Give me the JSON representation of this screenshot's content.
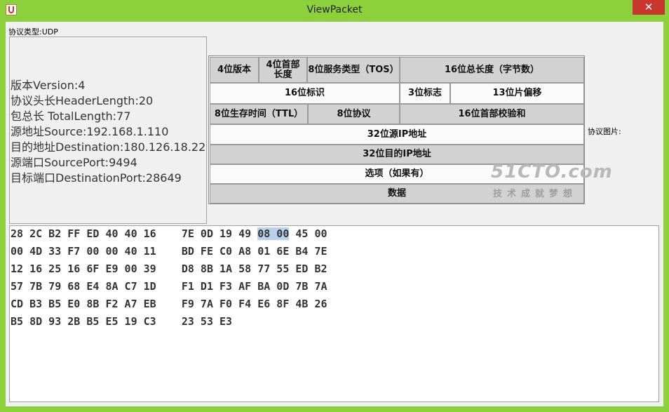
{
  "window": {
    "title": "ViewPacket",
    "close_glyph": "✕",
    "app_icon": "java-cup-icon"
  },
  "protocol_type": "协议类型:UDP",
  "info_lines": [
    "版本Version:4",
    "协议头长HeaderLength:20",
    "包总长 TotalLength:77",
    "源地址Source:192.168.1.110",
    "目的地址Destination:180.126.18.22",
    "源端口SourcePort:9494",
    "目标端口DestinationPort:28649"
  ],
  "diagram": {
    "version": "4位版本",
    "header_length": "4位首部\n长度",
    "tos": "8位服务类型（TOS）",
    "total_length": "16位总长度（字节数）",
    "identification": "16位标识",
    "flags": "3位标志",
    "fragment_offset": "13位片偏移",
    "ttl": "8位生存时间（TTL）",
    "protocol": "8位协议",
    "checksum": "16位首部校验和",
    "src_ip": "32位源IP地址",
    "dst_ip": "32位目的IP地址",
    "options": "选项（如果有）",
    "data": "数据",
    "watermark_logo": "51CTO.com",
    "watermark_slogan": "技术成就梦想"
  },
  "protocol_picture_label": "协议图片:",
  "hex_rows": [
    {
      "left": "28 2C B2 FF ED 40 40 16",
      "right_pre": "7E 0D 19 49 ",
      "right_hl": "08 00",
      "right_post": " 45 00"
    },
    {
      "left": "00 4D 33 F7 00 00 40 11",
      "right_pre": "BD FE C0 A8 01 6E B4 7E",
      "right_hl": "",
      "right_post": ""
    },
    {
      "left": "12 16 25 16 6F E9 00 39",
      "right_pre": "D8 8B 1A 58 77 55 ED B2",
      "right_hl": "",
      "right_post": ""
    },
    {
      "left": "57 7B 79 68 E4 8A C7 1D",
      "right_pre": "F1 D1 F3 AF BA 0D 7B 7A",
      "right_hl": "",
      "right_post": ""
    },
    {
      "left": "CD B3 B5 E0 8B F2 A7 EB",
      "right_pre": "F9 7A F0 F4 E6 8F 4B 26",
      "right_hl": "",
      "right_post": ""
    },
    {
      "left": "B5 8D 93 2B B5 E5 19 C3",
      "right_pre": "23 53 E3",
      "right_hl": "",
      "right_post": ""
    }
  ]
}
